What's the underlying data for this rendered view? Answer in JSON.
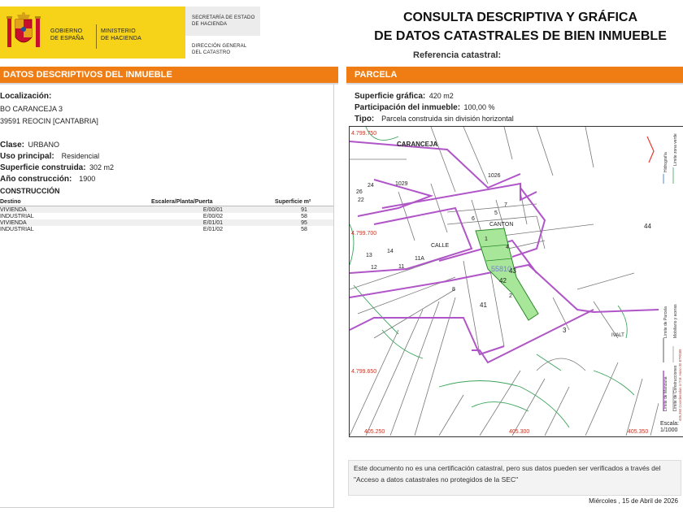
{
  "header": {
    "gov_line1": "GOBIERNO",
    "gov_line2": "DE ESPAÑA",
    "min_line1": "MINISTERIO",
    "min_line2": "DE HACIENDA",
    "sec_line1": "SECRETARÍA DE ESTADO",
    "sec_line2": "DE HACIENDA",
    "dir_line1": "DIRECCIÓN GENERAL",
    "dir_line2": "DEL CATASTRO",
    "title_line1": "CONSULTA DESCRIPTIVA Y GRÁFICA",
    "title_line2": "DE DATOS CATASTRALES DE BIEN INMUEBLE",
    "ref_label": "Referencia catastral:",
    "colors": {
      "accent": "#ef7d13",
      "yellow": "#f6d219"
    }
  },
  "left": {
    "bar_title": "DATOS DESCRIPTIVOS DEL INMUEBLE",
    "loc_label": "Localización:",
    "loc_line1": "BO CARANCEJA 3",
    "loc_line2": "39591 REOCIN [CANTABRIA]",
    "clase_label": "Clase:",
    "clase_value": "URBANO",
    "uso_label": "Uso principal:",
    "uso_value": "Residencial",
    "sup_label": "Superficie construida:",
    "sup_value": "302 m2",
    "anio_label": "Año construcción:",
    "anio_value": "1900",
    "constr_title": "CONSTRUCCIÓN",
    "table_headers": [
      "Destino",
      "Escalera/Planta/Puerta",
      "Superficie m²"
    ],
    "table_rows": [
      [
        "VIVIENDA",
        "E/00/01",
        "91"
      ],
      [
        "INDUSTRIAL",
        "E/00/02",
        "58"
      ],
      [
        "VIVIENDA",
        "E/01/01",
        "95"
      ],
      [
        "INDUSTRIAL",
        "E/01/02",
        "58"
      ]
    ]
  },
  "right": {
    "bar_title": "PARCELA",
    "supg_label": "Superficie gráfica:",
    "supg_value": "420 m2",
    "part_label": "Participación del inmueble:",
    "part_value": "100,00 %",
    "tipo_label": "Tipo:",
    "tipo_value": "Parcela construida sin división horizontal"
  },
  "map": {
    "street_label": "CARANCEJA",
    "calle_label": "CALLE",
    "canton_label": "CANTON",
    "coord_y1": "4.799.750",
    "coord_y2": "4.799.700",
    "coord_y3": "4.799.650",
    "coord_x1": "405.250",
    "coord_x2": "405.300",
    "coord_x3": "405.350",
    "parcel_ref": "55810",
    "nums": {
      "n44": "44",
      "n43": "43",
      "n42": "42",
      "n41": "41",
      "n3": "3",
      "n8": "8",
      "n11": "11",
      "n12": "12",
      "n13": "13",
      "n14": "14",
      "n11a": "11A",
      "n5": "5",
      "n6": "6",
      "n7": "7",
      "n1": "1",
      "n4": "4",
      "n2": "2",
      "n26": "26",
      "n24": "24",
      "n22": "22",
      "n1026": "1026",
      "n1029": "1029",
      "ivalt": "IVALT"
    },
    "legend": {
      "l1": "Límite de Manzana",
      "l2": "Límite de Parcela",
      "l3": "Límite de Construcciones",
      "l4": "Mobiliario y aceras",
      "l5": "Límite zona verde",
      "l6": "Hidrografía",
      "l7": "405,350 Coordenadas U.T.M. Huso 30 ETRS89"
    },
    "scale_label": "Escala:",
    "scale_value": "1/1000"
  },
  "footer": {
    "note": "Este documento no es una certificación catastral, pero sus datos pueden ser verificados a través del \"Acceso a datos catastrales no protegidos de la SEC\"",
    "date": "Miércoles , 15 de Abril de 2026"
  }
}
